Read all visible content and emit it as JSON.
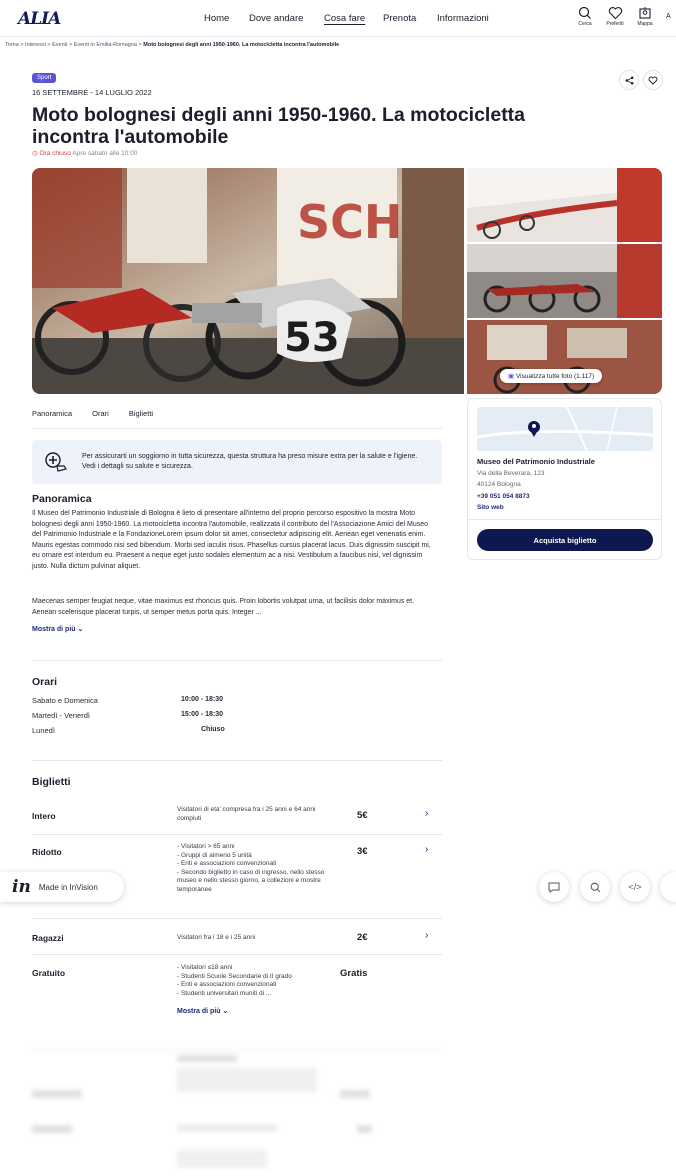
{
  "header": {
    "logo": "ALIA",
    "nav": [
      "Home",
      "Dove andare",
      "Cosa fare",
      "Prenota",
      "Informazioni"
    ],
    "active_nav": "Cosa fare",
    "icons": [
      {
        "name": "search-icon",
        "label": "Cerca"
      },
      {
        "name": "heart-icon",
        "label": "Preferiti"
      },
      {
        "name": "map-pin-icon",
        "label": "Mappa"
      }
    ],
    "lang": "A"
  },
  "breadcrumb": {
    "items": [
      "Torna",
      "Interessi",
      "Eventi",
      "Eventi in Emilia-Romagna"
    ],
    "current": "Moto bolognesi degli anni 1950-1960. La motocicletta incontra l'automobile"
  },
  "event": {
    "tag": "Sport",
    "dates": "16 SETTEMBRE - 14 LUGLIO 2022",
    "title": "Moto bolognesi degli anni 1950-1960. La motocicletta incontra l'automobile",
    "status_closed": "Ora chiuso",
    "status_next": "Apre sabato alle 10:00",
    "number_plate": "53"
  },
  "gallery": {
    "button_label": "Visualizza tutte foto (1.117)"
  },
  "tabs": [
    "Panoramica",
    "Orari",
    "Biglietti"
  ],
  "notice": "Per assicurarti un soggiorno in tutta sicurezza, questa struttura ha preso misure extra per la salute e l'igiene. Vedi i dettagli su salute e sicurezza.",
  "overview": {
    "heading": "Panoramica",
    "p1": "Il Museo del Patrimonio Industriale di Bologna è lieto di presentare all'interno del proprio percorso espositivo la mostra Moto bolognesi degli anni 1950-1960. La motocicletta incontra l'automobile, realizzata il contributo del l'Associazione Amici del Museo del Patrimonio Industriale e la FondazioneLorem ipsum dolor sit amet, consectetur adipiscing elit. Aenean eget venenatis enim. Mauris egestas commodo nisi sed bibendum. Morbi sed iaculis risus. Phasellus cursus placerat lacus. Duis dignissim suscipit mi, eu ornare est interdum eu. Praesent a neque eget justo sodales elementum ac a nisi. Vestibulum a faucibus nisi, vel dignissim justo. Nulla dictum pulvinar aliquet.",
    "p2": "Maecenas semper feugiat neque, vitae maximus est rhoncus quis. Proin lobortis volutpat urna, ut facilisis dolor maximus et. Aenean scelerisque placerat turpis, ut semper metus porta quis. Integer ...",
    "more": "Mostra di più"
  },
  "venue": {
    "name": "Museo del Patrimonio Industriale",
    "street": "Via della Beverara, 123",
    "city": "40124 Bologna",
    "phone": "+39 051 054 8873",
    "website": "Sito web",
    "buy": "Acquista biglietto"
  },
  "hours": {
    "heading": "Orari",
    "rows": [
      {
        "day": "Sabato e Domenica",
        "time": "10:00 - 18:30"
      },
      {
        "day": "Martedì - Venerdì",
        "time": "15:00 - 18:30"
      },
      {
        "day": "Lunedì",
        "time": "Chiuso"
      }
    ]
  },
  "tickets": {
    "heading": "Biglietti",
    "items": [
      {
        "name": "Intero",
        "desc": "Visitatori di eta' compresa fra i 25 anni e 64 anni compiuti",
        "price": "5€"
      },
      {
        "name": "Ridotto",
        "desc": "- Visitatori > 65 anni\n- Gruppi di almeno 5 unità\n- Enti e associazioni convenzionati\n- Secondo biglietto in caso di ingresso, nello stesso museo e nello stesso giorno, a collezioni e mostre temporanee",
        "price": "3€"
      },
      {
        "name": "Ragazzi",
        "desc": "Visitatori fra i 18 e i 25 anni",
        "price": "2€"
      },
      {
        "name": "Gratuito",
        "desc": "- Visitatori ≤18 anni\n- Studenti Scuole Secondarie di II grado\n- Enti e associazioni convenzionati\n- Studenti universitari muniti di ...",
        "price": "Gratis"
      }
    ],
    "more": "Mostra di più"
  },
  "invision": {
    "label": "Made in InVision",
    "logo": "in"
  },
  "toolbar_icons": [
    "comment-icon",
    "search-icon",
    "code-icon"
  ],
  "toolbar_code": "</>"
}
